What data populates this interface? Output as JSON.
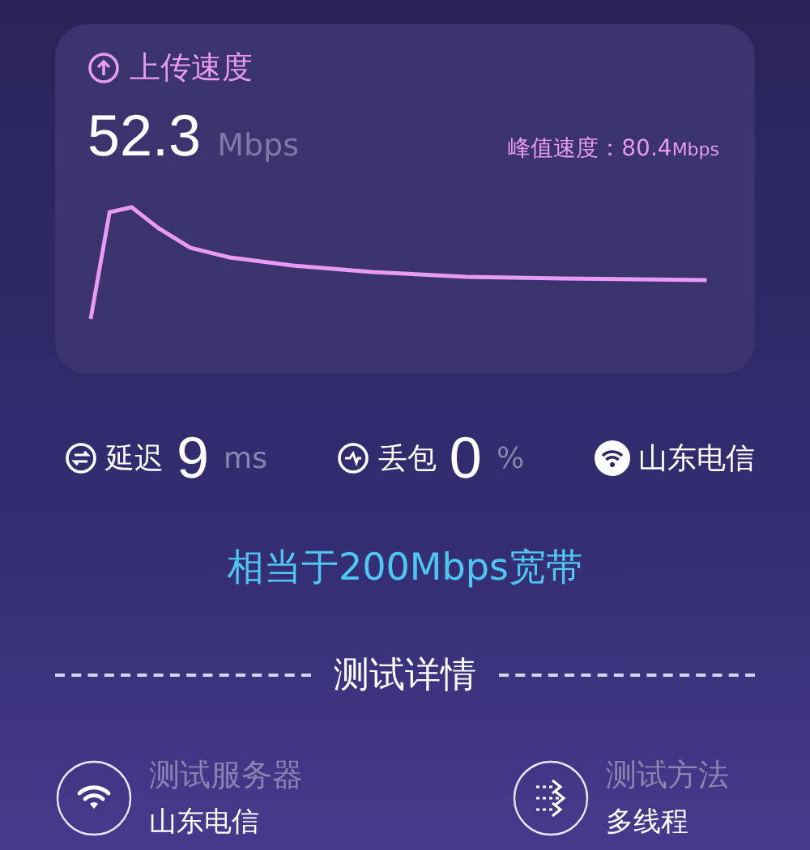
{
  "upload": {
    "title": "上传速度",
    "value": "52.3",
    "unit": "Mbps",
    "peak_label": "峰值速度：",
    "peak_value": "80.4",
    "peak_unit": "Mbps"
  },
  "stats": [
    {
      "kind": "latency",
      "label": "延迟",
      "value": "9",
      "unit": "ms"
    },
    {
      "kind": "loss",
      "label": "丢包",
      "value": "0",
      "unit": "%"
    },
    {
      "kind": "carrier",
      "label": "山东电信"
    }
  ],
  "equivalent": "相当于200Mbps宽带",
  "details": {
    "title": "测试详情",
    "items": [
      {
        "kind": "server",
        "label": "测试服务器",
        "value": "山东电信"
      },
      {
        "kind": "method",
        "label": "测试方法",
        "value": "多线程"
      }
    ]
  }
}
